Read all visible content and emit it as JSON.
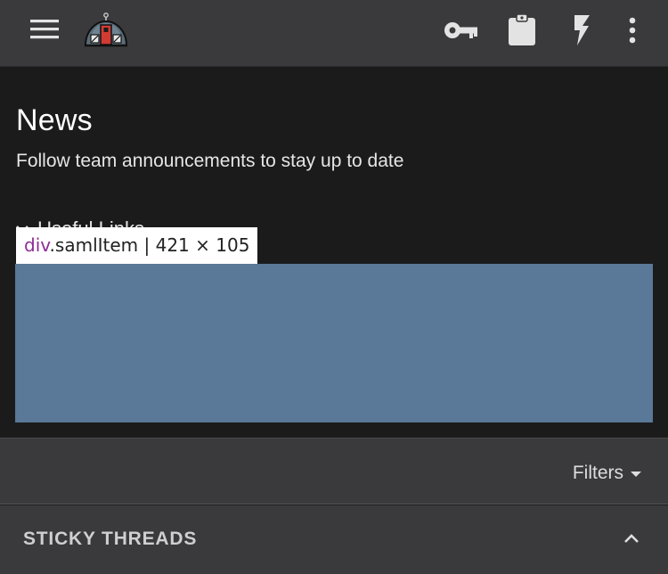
{
  "header": {
    "icons": [
      "menu-icon",
      "logo-observatory",
      "key-icon",
      "clipboard-icon",
      "bolt-icon",
      "more-vert-icon"
    ]
  },
  "page": {
    "title": "News",
    "subtitle": "Follow team announcements to stay up to date",
    "partial_link": "Useful Links"
  },
  "inspector": {
    "tag": "div",
    "class": ".samlItem",
    "separator": " | ",
    "dims": "421 × 105"
  },
  "filters": {
    "label": "Filters"
  },
  "sticky": {
    "title": "STICKY THREADS"
  },
  "colors": {
    "topbar": "#3a393b",
    "background": "#1b1b1c",
    "highlight": "#5a7897",
    "accent_red": "#d23b33"
  }
}
